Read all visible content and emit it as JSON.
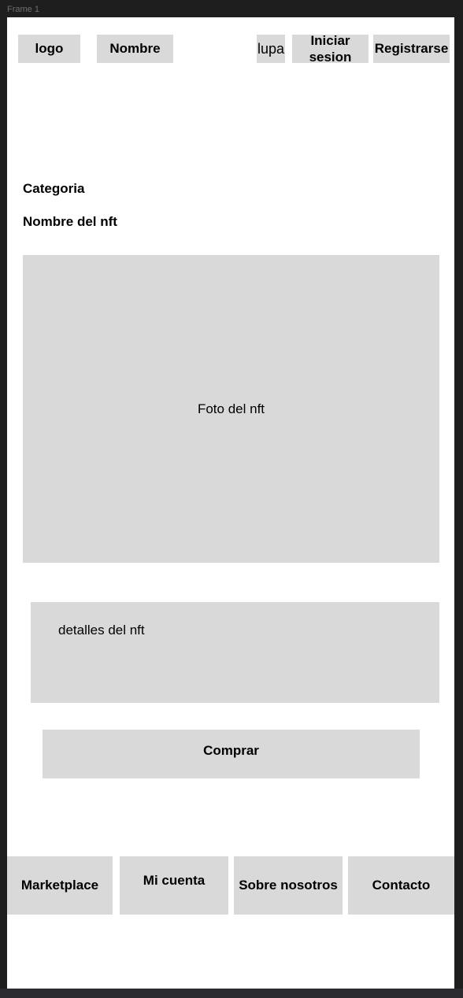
{
  "frame": {
    "label": "Frame 1"
  },
  "header": {
    "logo": "logo",
    "name": "Nombre",
    "search": "lupa",
    "login": "Iniciar sesion",
    "register": "Registrarse"
  },
  "product": {
    "category": "Categoria",
    "name": "Nombre del nft",
    "photo": "Foto del nft",
    "details": "detalles del nft",
    "buy": "Comprar"
  },
  "footer": {
    "items": [
      {
        "label": "Marketplace"
      },
      {
        "label": "Mi cuenta"
      },
      {
        "label": "Sobre nosotros"
      },
      {
        "label": "Contacto"
      }
    ]
  },
  "colors": {
    "placeholder": "#d9d9d9",
    "canvas": "#1e1e1e",
    "frame": "#ffffff"
  }
}
